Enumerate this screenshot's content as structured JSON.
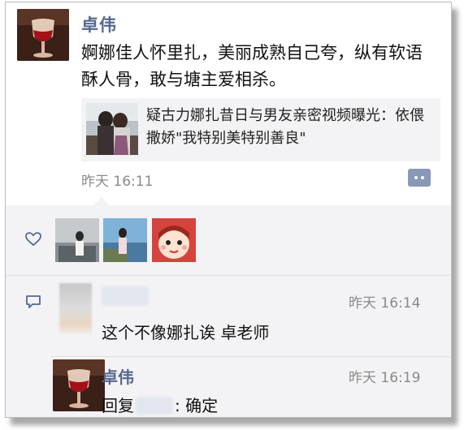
{
  "post": {
    "author": "卓伟",
    "text": "婀娜佳人怀里扎，美丽成熟自己夸，纵有软语酥人骨，敢与塘主爱相杀。",
    "share_card": {
      "title": "疑古力娜扎昔日与男友亲密视频曝光：依偎撒娇\"我特别美特别善良\""
    },
    "time": "昨天 16:11"
  },
  "likes": {
    "icon": "heart-outline-icon",
    "avatars": [
      "liker-1",
      "liker-2",
      "liker-3"
    ]
  },
  "comments": [
    {
      "author": "",
      "time": "昨天 16:14",
      "text": "这个不像娜扎诶 卓老师"
    },
    {
      "author": "卓伟",
      "time": "昨天 16:19",
      "reply_prefix": "回复",
      "reply_suffix": ": 确定"
    }
  ],
  "colors": {
    "name_blue": "#56688f",
    "panel_bg": "#f3f3f5",
    "time_gray": "#8a8a8a"
  }
}
